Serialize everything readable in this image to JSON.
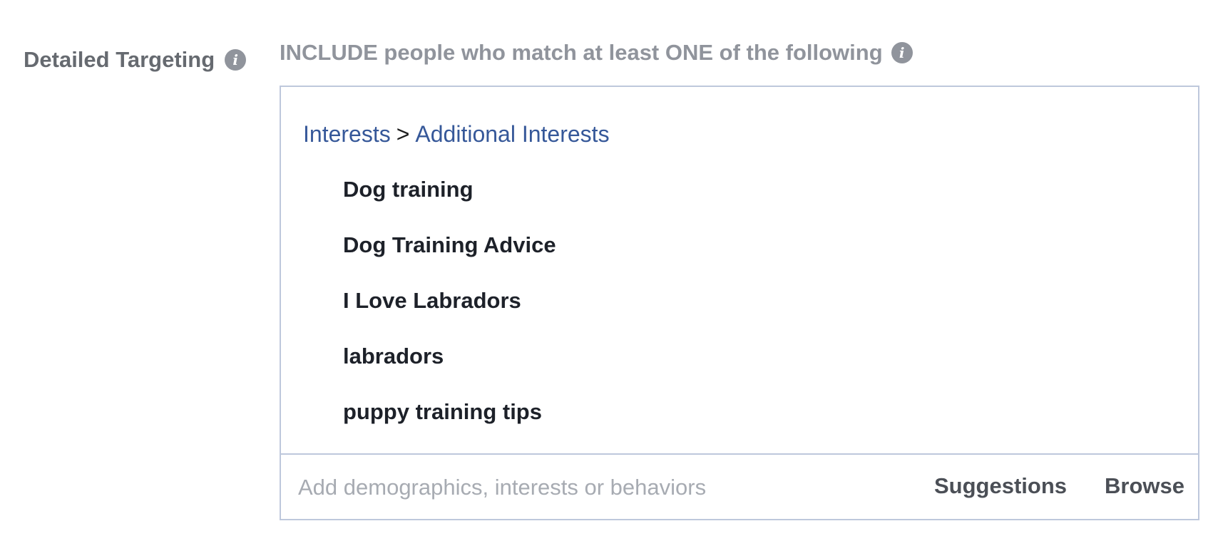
{
  "detailed_targeting": {
    "label": "Detailed Targeting",
    "info_icon": "info-icon"
  },
  "include_section": {
    "heading": "INCLUDE people who match at least ONE of the following",
    "info_icon": "info-icon"
  },
  "breadcrumb": {
    "level1": "Interests",
    "separator": ">",
    "level2": "Additional Interests"
  },
  "interests": [
    "Dog training",
    "Dog Training Advice",
    "I Love Labradors",
    "labradors",
    "puppy training tips"
  ],
  "search": {
    "value": "",
    "placeholder": "Add demographics, interests or behaviors"
  },
  "actions": {
    "suggestions_label": "Suggestions",
    "browse_label": "Browse"
  },
  "colors": {
    "link": "#365899",
    "box_border": "#bec8dc",
    "label": "#666a70",
    "muted": "#90949c"
  }
}
